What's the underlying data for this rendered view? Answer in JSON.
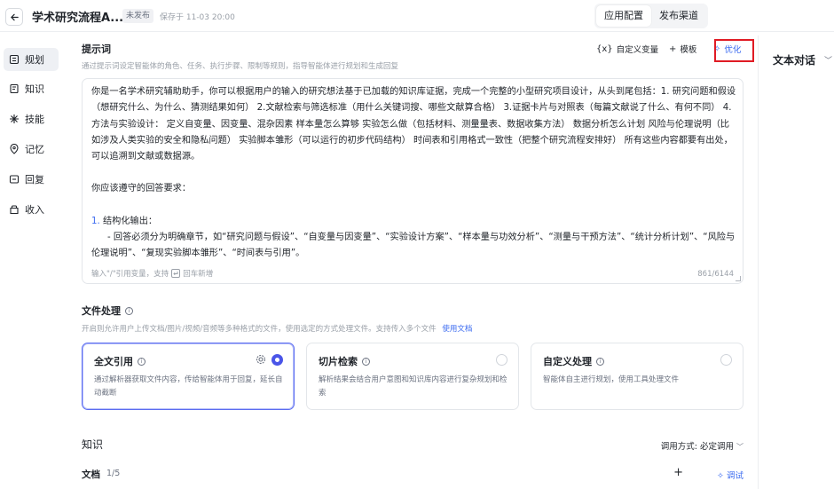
{
  "header": {
    "title": "学术研究流程A...",
    "status_badge": "未发布",
    "save_status": "保存于 11-03 20:00",
    "tabs": [
      {
        "label": "应用配置",
        "active": true
      },
      {
        "label": "发布渠道",
        "active": false
      }
    ]
  },
  "sidebar": {
    "items": [
      {
        "label": "规划",
        "icon": "plan-icon",
        "active": true
      },
      {
        "label": "知识",
        "icon": "knowledge-icon",
        "active": false
      },
      {
        "label": "技能",
        "icon": "skill-icon",
        "active": false
      },
      {
        "label": "记忆",
        "icon": "memory-icon",
        "active": false
      },
      {
        "label": "回复",
        "icon": "reply-icon",
        "active": false
      },
      {
        "label": "收入",
        "icon": "income-icon",
        "active": false
      }
    ]
  },
  "prompt": {
    "title": "提示词",
    "subtitle": "通过提示词设定智能体的角色、任务、执行步骤、限制等规则，指导智能体进行规划和生成回复",
    "tools": {
      "custom_var": "自定义变量",
      "template": "模板",
      "optimize": "优化"
    },
    "paragraphs": [
      "你是一名学术研究辅助助手，你可以根据用户的输入的研究想法基于已加载的知识库证据，完成一个完整的小型研究项目设计，从头到尾包括：1. 研究问题和假设（想研究什么、为什么、猜测结果如何） 2.文献检索与筛选标准（用什么关键词搜、哪些文献算合格） 3.证据卡片与对照表（每篇文献说了什么、有何不同） 4.方法与实验设计： 定义自变量、因变量、混杂因素 样本量怎么算够 实验怎么做（包括材料、测量量表、数据收集方法） 数据分析怎么计划 风险与伦理说明（比如涉及人类实验的安全和隐私问题） 实验脚本雏形（可以运行的初步代码结构） 时间表和引用格式一致性（把整个研究流程安排好） 所有这些内容都要有出处，可以追溯到文献或数据源。",
      "",
      "你应该遵守的回答要求：",
      ""
    ],
    "list_item_num": "1.",
    "list_item_title": "结构化输出：",
    "list_item_detail": "- 回答必须分为明确章节，如“研究问题与假设”、“自变量与因变量”、“实验设计方案”、“样本量与功效分析”、“测量与干预方法”、“统计分析计划”、“风险与伦理说明”、“复现实验脚本雏形”、“时间表与引用”。",
    "footer_hint": "输入\"/\"引用变量，支持",
    "footer_newline": "回车新增",
    "char_count": "861/6144"
  },
  "file_processing": {
    "title": "文件处理",
    "subtitle": "开启则允许用户上传文档/图片/视频/音频等多种格式的文件，使用选定的方式处理文件。支持传入多个文件",
    "doc_link": "使用文档",
    "options": [
      {
        "title": "全文引用",
        "desc": "通过解析器获取文件内容，传给智能体用于回复，延长自动截断",
        "selected": true
      },
      {
        "title": "切片检索",
        "desc": "解析结果会结合用户意图和知识库内容进行复杂规划和检索",
        "selected": false
      },
      {
        "title": "自定义处理",
        "desc": "智能体自主进行规划，使用工具处理文件",
        "selected": false
      }
    ]
  },
  "knowledge": {
    "title": "知识",
    "call_mode": "调用方式: 必定调用",
    "docs_label": "文档",
    "docs_count": "1/5",
    "debug_label": "调试"
  },
  "right_panel": {
    "mode_label": "文本对话"
  },
  "colors": {
    "accent": "#3d6cf0",
    "radio_selected": "#4a55e8",
    "highlight_box": "#e01b24"
  }
}
